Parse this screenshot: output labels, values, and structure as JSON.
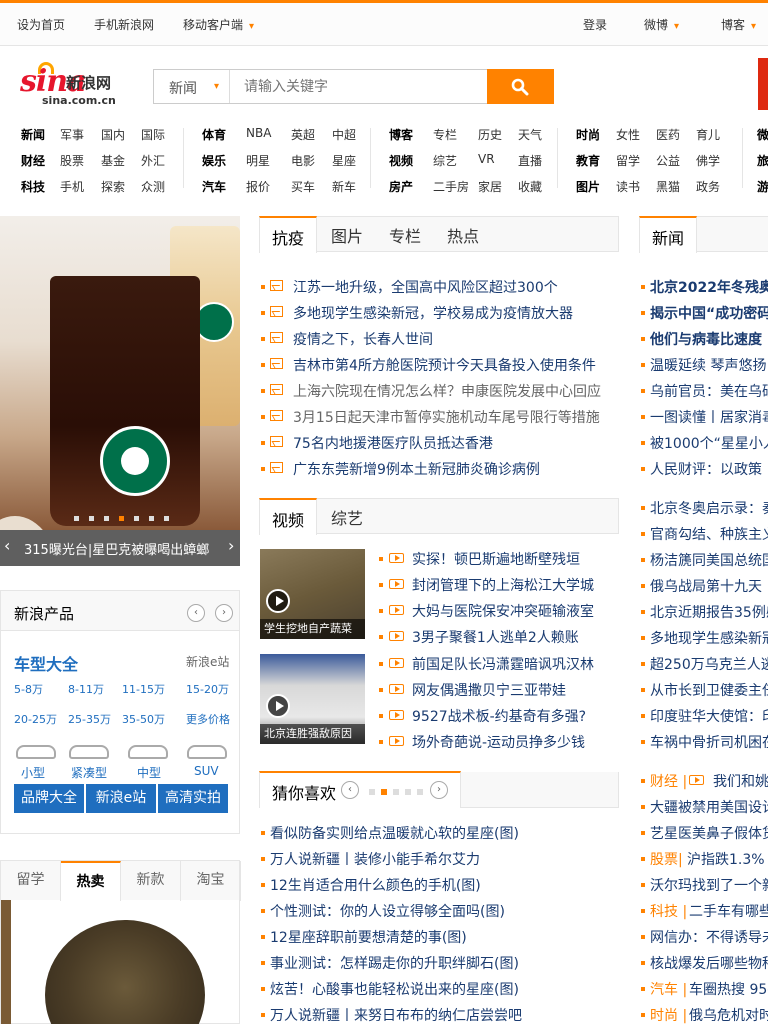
{
  "topbar": {
    "set_home": "设为首页",
    "mobile_sina": "手机新浪网",
    "mobile_client": "移动客户端",
    "login": "登录",
    "weibo": "微博",
    "blog": "博客"
  },
  "logo": {
    "mark": "sina",
    "name_cn": "新浪网",
    "domain": "sina.com.cn"
  },
  "search": {
    "category": "新闻",
    "placeholder": "请输入关键字"
  },
  "nav": [
    [
      "新闻",
      "军事",
      "国内",
      "国际"
    ],
    [
      "财经",
      "股票",
      "基金",
      "外汇"
    ],
    [
      "科技",
      "手机",
      "探索",
      "众测"
    ],
    [
      "体育",
      "NBA",
      "英超",
      "中超"
    ],
    [
      "娱乐",
      "明星",
      "电影",
      "星座"
    ],
    [
      "汽车",
      "报价",
      "买车",
      "新车"
    ],
    [
      "博客",
      "专栏",
      "历史",
      "天气"
    ],
    [
      "视频",
      "综艺",
      "VR",
      "直播"
    ],
    [
      "房产",
      "二手房",
      "家居",
      "收藏"
    ],
    [
      "时尚",
      "女性",
      "医药",
      "育儿"
    ],
    [
      "教育",
      "留学",
      "公益",
      "佛学"
    ],
    [
      "图片",
      "读书",
      "黑猫",
      "政务"
    ],
    [
      "微"
    ],
    [
      "旅"
    ],
    [
      "游"
    ]
  ],
  "slider": {
    "caption": "315曝光台|星巴克被曝喝出蟑螂",
    "dot_count": 7,
    "active_dot": 4
  },
  "products": {
    "title": "新浪产品",
    "car_title": "车型大全",
    "car_site": "新浪e站",
    "price_links": [
      "5-8万",
      "8-11万",
      "11-15万",
      "15-20万",
      "20-25万",
      "25-35万",
      "35-50万",
      "更多价格"
    ],
    "car_types": [
      "小型",
      "紧凑型",
      "中型",
      "SUV"
    ],
    "buttons": [
      "品牌大全",
      "新浪e站",
      "高清实拍"
    ]
  },
  "shop": {
    "tabs": [
      "留学",
      "热卖",
      "新款",
      "淘宝"
    ],
    "active_tab": 1
  },
  "mid": {
    "tabs1": [
      "抗疫",
      "图片",
      "专栏",
      "热点"
    ],
    "news1": [
      "江苏一地升级，全国高中风险区超过300个",
      "多地现学生感染新冠，学校易成为疫情放大器",
      "疫情之下，长春人世间",
      "吉林市第4所方舱医院预计今天具备投入使用条件",
      "上海六院现在情况怎么样？申康医院发展中心回应",
      "3月15日起天津市暂停实施机动车尾号限行等措施",
      "75名内地援港医疗队员抵达香港",
      "广东东莞新增9例本土新冠肺炎确诊病例"
    ],
    "tabs2": [
      "视频",
      "综艺"
    ],
    "video_thumbs": [
      "学生挖地自产蔬菜",
      "北京连胜强敌原因"
    ],
    "videos": [
      "实探！顿巴斯遍地断壁残垣",
      "封闭管理下的上海松江大学城",
      "大妈与医院保安冲突砸输液室",
      "3男子聚餐1人逃单2人赖账",
      "前国足队长冯潇霆暗讽巩汉林",
      "网友偶遇撒贝宁三亚带娃",
      "9527战术板-约基奇有多强?",
      "场外奇葩说-运动员挣多少钱"
    ],
    "guess_title": "猜你喜欢",
    "guess": [
      "看似防备实则给点温暖就心软的星座(图)",
      "万人说新疆丨装修小能手希尔艾力",
      "12生肖适合用什么颜色的手机(图)",
      "个性测试：你的人设立得够全面吗(图)",
      "12星座辞职前要想清楚的事(图)",
      "事业测试：怎样踢走你的升职绊脚石(图)",
      "炫苦！心酸事也能轻松说出来的星座(图)",
      "万人说新疆丨来努日布布的纳仁店尝尝吧"
    ]
  },
  "right": {
    "tab": "新闻",
    "lines": [
      {
        "text": "北京2022年冬残奥会",
        "bold": true
      },
      {
        "text": "揭示中国“成功密码",
        "bold": true
      },
      {
        "text": "他们与病毒比速度 ",
        "bold": true
      },
      {
        "text": "温暖延续 琴声悠扬",
        "bold": false
      },
      {
        "text": "乌前官员：美在乌研",
        "bold": false
      },
      {
        "text": "一图读懂丨居家消毒",
        "bold": false
      },
      {
        "text": "被1000个“星星小人",
        "bold": false
      },
      {
        "text": "人民财评：以政策",
        "bold": false
      },
      {
        "text": "北京冬奥启示录：奏",
        "bold": false
      },
      {
        "text": "官商勾结、种族主义",
        "bold": false
      },
      {
        "text": "杨洁篪同美国总统国",
        "bold": false
      },
      {
        "text": "俄乌战局第十九天 ",
        "bold": false
      },
      {
        "text": "北京近期报告35例感",
        "bold": false
      },
      {
        "text": "多地现学生感染新冠",
        "bold": false
      },
      {
        "text": "超250万乌克兰人逃",
        "bold": false
      },
      {
        "text": "从市长到卫健委主任",
        "bold": false
      },
      {
        "text": "印度驻华大使馆：印",
        "bold": false
      },
      {
        "text": "车祸中骨折司机困在",
        "bold": false
      }
    ],
    "cat_lines": [
      {
        "cat": "财经 |",
        "text": "我们和姚"
      },
      {
        "cat": "",
        "text": "大疆被禁用美国设计"
      },
      {
        "cat": "",
        "text": "艺星医美鼻子假体货"
      },
      {
        "cat": "股票|",
        "text": "沪指跌1.3% 港"
      },
      {
        "cat": "",
        "text": "沃尔玛找到了一个新"
      },
      {
        "cat": "科技 |",
        "text": "二手车有哪些"
      },
      {
        "cat": "",
        "text": "网信办：不得诱导未"
      },
      {
        "cat": "",
        "text": "核战爆发后哪些物种"
      },
      {
        "cat": "汽车 |",
        "text": "车圈热搜 95-"
      },
      {
        "cat": "时尚 |",
        "text": "俄乌危机对时"
      }
    ]
  },
  "colors": {
    "accent": "#ff8200",
    "link": "#1a3b70",
    "blue": "#1f6ebf",
    "brand_red": "#e6162d"
  }
}
